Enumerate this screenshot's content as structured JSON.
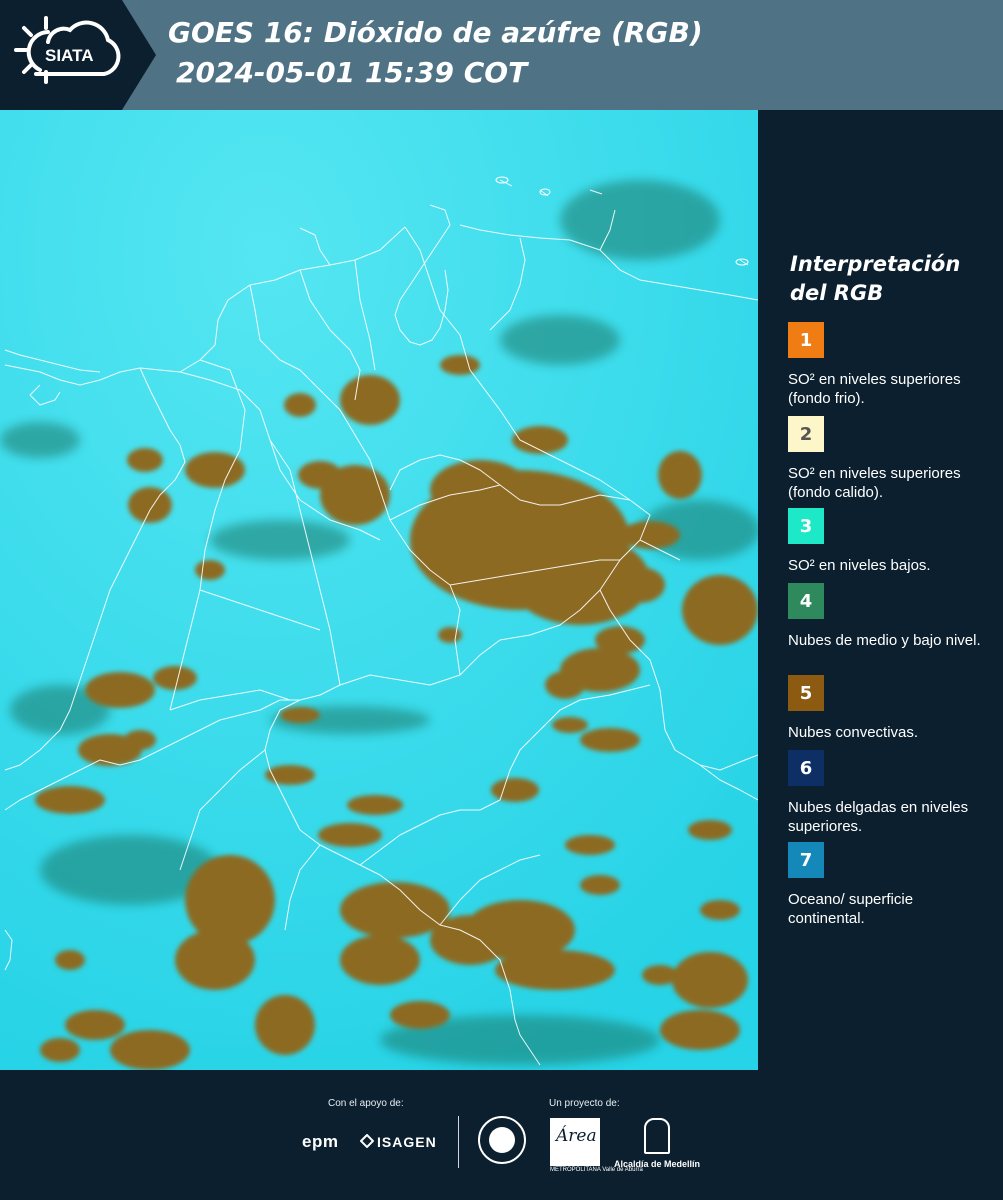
{
  "header": {
    "logo_text": "SIATA",
    "title_line1": "GOES 16: Dióxido de azúfre (RGB)",
    "title_line2": "2024-05-01 15:39 COT"
  },
  "map": {
    "background_color": "#37dcec",
    "cloud_color": "#8c6a22",
    "boundary_color": "#ffffff"
  },
  "legend": {
    "title": "Interpretación del RGB",
    "items": [
      {
        "number": "1",
        "color": "#f07d14",
        "text": "SO² en niveles superiores (fondo frio)."
      },
      {
        "number": "2",
        "color": "#fdf6c8",
        "text": "SO² en niveles superiores (fondo calido)."
      },
      {
        "number": "3",
        "color": "#1de8c8",
        "text": "SO² en niveles bajos."
      },
      {
        "number": "4",
        "color": "#2e8a5c",
        "text": "Nubes de medio y bajo nivel."
      },
      {
        "number": "5",
        "color": "#8c5a10",
        "text": "Nubes convectivas."
      },
      {
        "number": "6",
        "color": "#0e2f66",
        "text": "Nubes delgadas en niveles superiores."
      },
      {
        "number": "7",
        "color": "#1488b8",
        "text": "Oceano/ superficie continental."
      }
    ]
  },
  "footer": {
    "support_label": "Con el apoyo de:",
    "project_label": "Un proyecto de:",
    "sponsor_1": "epm",
    "sponsor_2": "ISAGEN",
    "partner_1": "Área",
    "partner_1_sub": "METROPOLITANA Valle de Aburrá",
    "partner_2": "Alcaldía de Medellín"
  }
}
